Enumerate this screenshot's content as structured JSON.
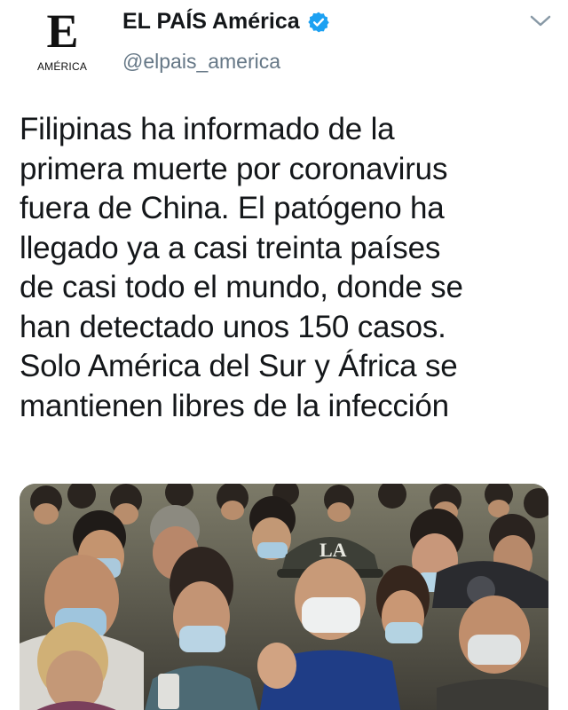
{
  "account": {
    "logo_letter": "E",
    "logo_sub": "AMÉRICA",
    "name": "EL PAÍS América",
    "handle": "@elpais_america"
  },
  "icons": {
    "verified": "verified-badge-icon",
    "menu": "chevron-down-icon"
  },
  "colors": {
    "verified": "#1da1f2",
    "handle": "#657786",
    "text": "#14171a"
  },
  "tweet": {
    "lines": [
      "Filipinas ha informado de la",
      "primera muerte por coronavirus",
      "fuera de China. El patógeno ha",
      "llegado ya a casi treinta países",
      "de casi todo el mundo, donde se",
      "han detectado unos 150 casos.",
      "Solo América del Sur y África se",
      "mantienen libres de la infección"
    ]
  },
  "media": {
    "cap_text": "LA"
  }
}
